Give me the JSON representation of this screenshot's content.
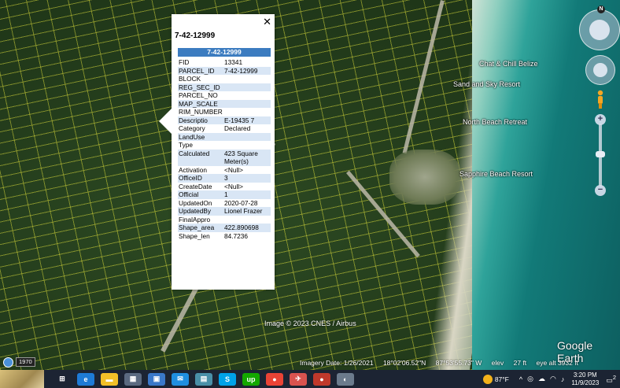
{
  "map": {
    "place_labels": [
      "Chat & Chill Belize",
      "Sand and Sky Resort",
      "North Beach Retreat",
      "Sapphire Beach Resort"
    ],
    "copyright": "Image © 2023 CNES / Airbus",
    "logo": "Google Earth",
    "year": "1970",
    "status": {
      "imagery_date": "Imagery Date: 1/26/2021",
      "lat": "18°02'06.52\"N",
      "lon": "87°53'55.73\" W",
      "elev_label": "elev",
      "elev_value": "27 ft",
      "eye_alt": "eye alt  3932 ft"
    }
  },
  "popup": {
    "title": "7-42-12999",
    "header": "7-42-12999",
    "close": "✕",
    "rows": [
      {
        "k": "FID",
        "v": "13341"
      },
      {
        "k": "PARCEL_ID",
        "v": "7-42-12999"
      },
      {
        "k": "BLOCK",
        "v": ""
      },
      {
        "k": "REG_SEC_ID",
        "v": ""
      },
      {
        "k": "PARCEL_NO",
        "v": ""
      },
      {
        "k": "MAP_SCALE",
        "v": ""
      },
      {
        "k": "RIM_NUMBER",
        "v": ""
      },
      {
        "k": "Descriptio",
        "v": "E-19435 7"
      },
      {
        "k": "Category",
        "v": "Declared"
      },
      {
        "k": "LandUse",
        "v": ""
      },
      {
        "k": "Type",
        "v": ""
      },
      {
        "k": "Calculated",
        "v": "423 Square Meter(s)"
      },
      {
        "k": "Activation",
        "v": "<Null>"
      },
      {
        "k": "OfficeID",
        "v": "3"
      },
      {
        "k": "CreateDate",
        "v": "<Null>"
      },
      {
        "k": "Official",
        "v": "1"
      },
      {
        "k": "UpdatedOn",
        "v": "2020-07-28"
      },
      {
        "k": "UpdatedBy",
        "v": "Lionel Frazer"
      },
      {
        "k": "FinalAppro",
        "v": ""
      },
      {
        "k": "Shape_area",
        "v": "422.890698"
      },
      {
        "k": "Shape_len",
        "v": "84.7236"
      }
    ]
  },
  "nav": {
    "north": "N",
    "zoom_in": "+",
    "zoom_out": "−"
  },
  "taskbar": {
    "icons": [
      "task-view-icon",
      "edge-icon",
      "file-explorer-icon",
      "calculator-icon",
      "store-icon",
      "mail-icon",
      "notes-icon",
      "skype-icon",
      "upwork-icon",
      "chrome-icon",
      "app-icon",
      "chrome-profile-icon",
      "google-earth-icon"
    ],
    "temperature": "87°F",
    "time": "3:20 PM",
    "date": "11/9/2023",
    "notifications": "2"
  },
  "colors": {
    "popup_header": "#3c7cc0",
    "popup_alt_row": "#d9e6f5",
    "taskbar": "#1c2433"
  }
}
